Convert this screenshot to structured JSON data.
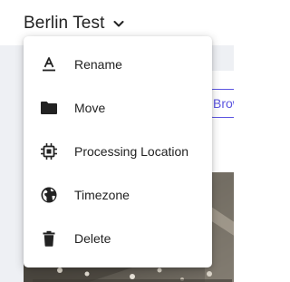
{
  "header": {
    "title": "Berlin Test",
    "title_chevron_icon": "chevron-down-icon"
  },
  "background": {
    "browse_button_label": "Brow"
  },
  "menu": {
    "items": [
      {
        "label": "Rename",
        "icon": "rename-icon"
      },
      {
        "label": "Move",
        "icon": "folder-icon"
      },
      {
        "label": "Processing Location",
        "icon": "chip-icon"
      },
      {
        "label": "Timezone",
        "icon": "globe-icon"
      },
      {
        "label": "Delete",
        "icon": "trash-icon"
      }
    ]
  },
  "colors": {
    "text": "#222222",
    "accent": "#5b54e0",
    "icon": "#222222"
  }
}
